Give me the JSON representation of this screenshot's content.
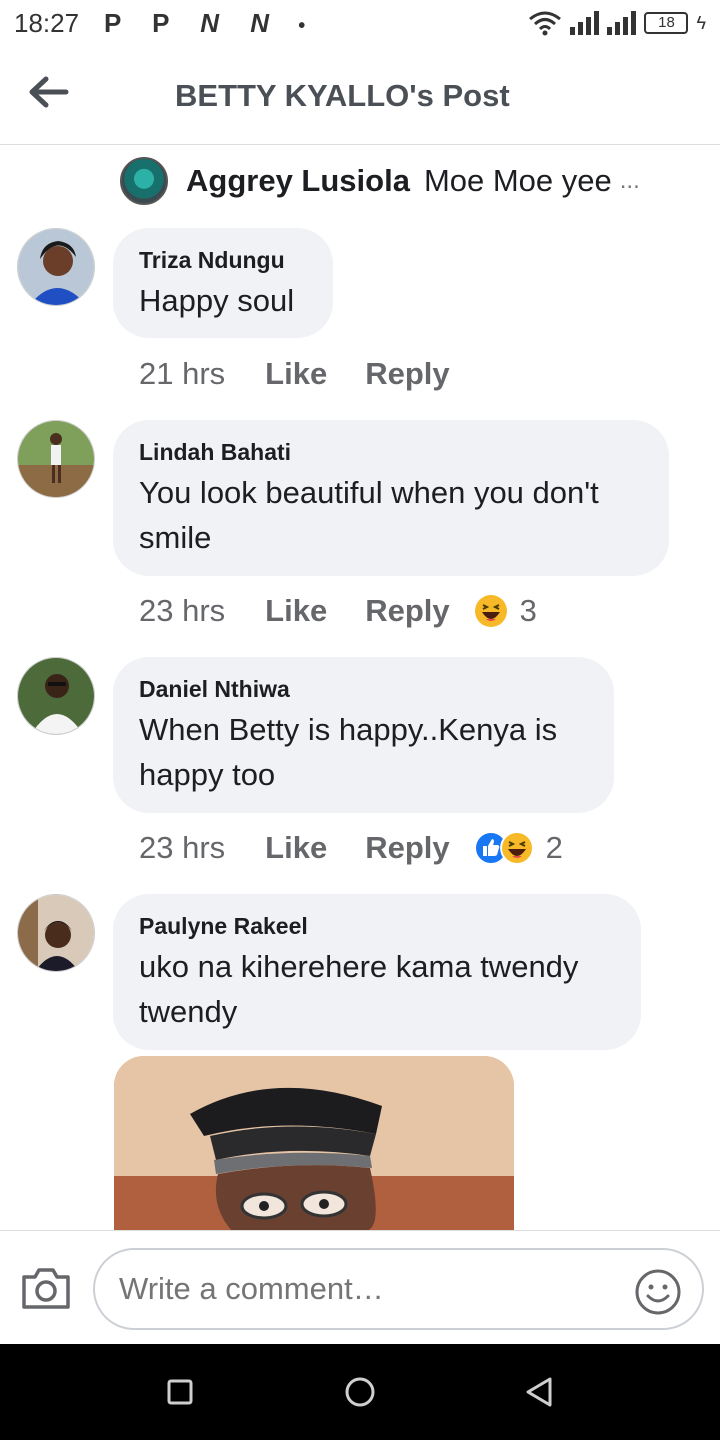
{
  "status_bar": {
    "time": "18:27",
    "app_icons": [
      "P",
      "P",
      "N",
      "N",
      "•"
    ],
    "battery": "18"
  },
  "header": {
    "title": "BETTY KYALLO's Post",
    "back_icon": "back-arrow-icon"
  },
  "parent_comment": {
    "author": "Aggrey Lusiola",
    "text": "Moe Moe yee",
    "ellipsis": "..."
  },
  "comments": [
    {
      "author": "Triza Ndungu",
      "text": "Happy soul",
      "time": "21 hrs",
      "like": "Like",
      "reply": "Reply",
      "reaction_count": ""
    },
    {
      "author": "Lindah Bahati",
      "text": "You look beautiful when you don't smile",
      "time": "23 hrs",
      "like": "Like",
      "reply": "Reply",
      "reactions": [
        "haha"
      ],
      "reaction_count": "3"
    },
    {
      "author": "Daniel Nthiwa",
      "text": "When Betty is happy..Kenya is happy too",
      "time": "23 hrs",
      "like": "Like",
      "reply": "Reply",
      "reactions": [
        "like",
        "haha"
      ],
      "reaction_count": "2"
    },
    {
      "author": "Paulyne Rakeel",
      "text": "uko na kiherehere kama twendy twendy",
      "time": "",
      "has_photo": true
    }
  ],
  "composer": {
    "placeholder": "Write a comment…"
  },
  "colors": {
    "bubble": "#f0f2f5",
    "meta_text": "#65676b",
    "like_blue": "#1877f2",
    "haha_yellow": "#f7b928"
  }
}
